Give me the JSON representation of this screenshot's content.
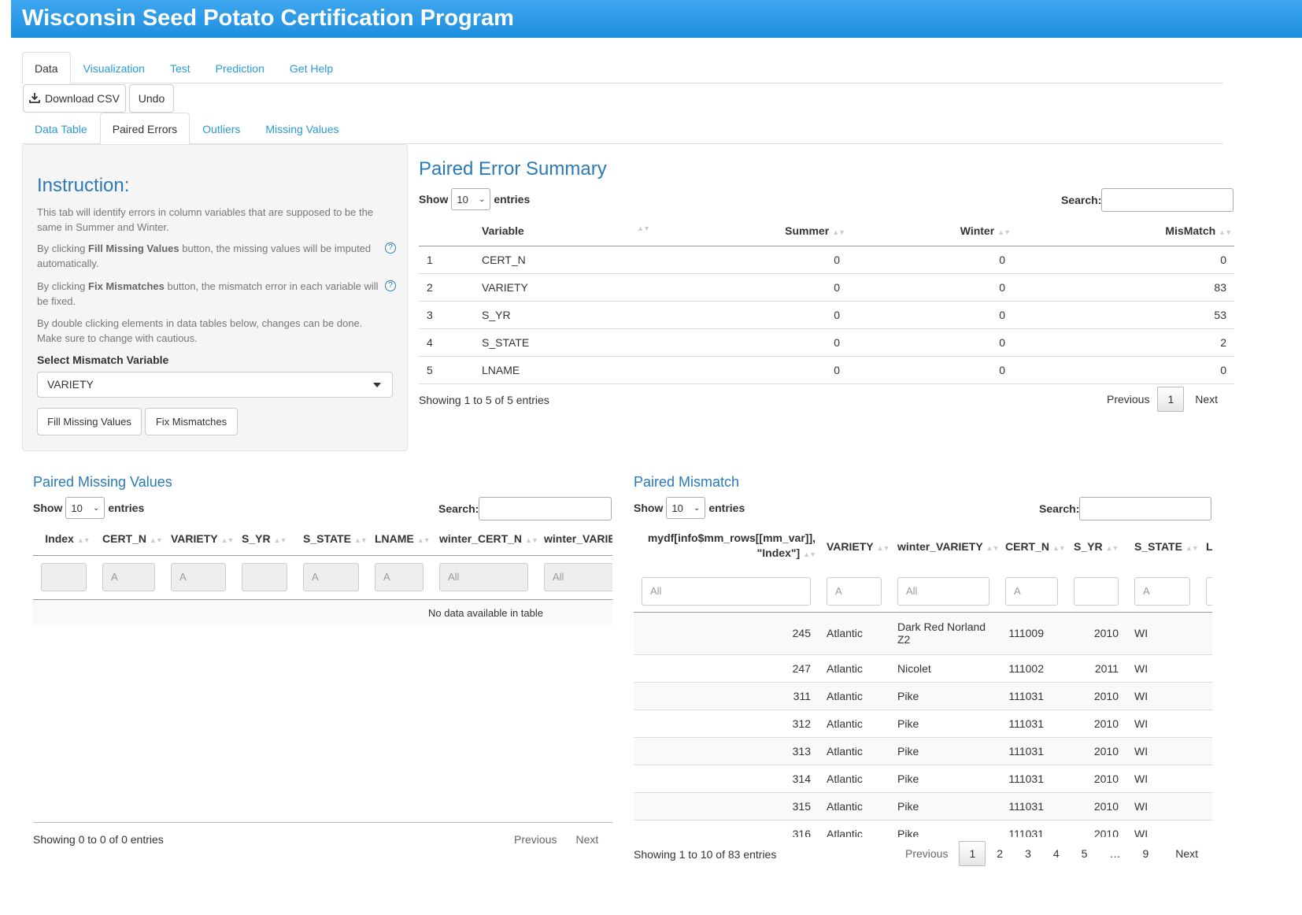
{
  "app": {
    "title": "Wisconsin Seed Potato Certification Program"
  },
  "main_tabs": [
    {
      "label": "Data",
      "active": true
    },
    {
      "label": "Visualization"
    },
    {
      "label": "Test"
    },
    {
      "label": "Prediction"
    },
    {
      "label": "Get Help"
    }
  ],
  "toolbar": {
    "download_label": "Download CSV",
    "undo_label": "Undo"
  },
  "sub_tabs": [
    {
      "label": "Data Table"
    },
    {
      "label": "Paired Errors",
      "active": true
    },
    {
      "label": "Outliers"
    },
    {
      "label": "Missing Values"
    }
  ],
  "sidebar": {
    "title": "Instruction:",
    "p1": "This tab will identify errors in column variables that are supposed to be the same in Summer and Winter.",
    "p2_prefix": "By clicking ",
    "p2_bold": "Fill Missing Values",
    "p2_suffix": " button, the missing values will be imputed automatically.",
    "p3_prefix": "By clicking ",
    "p3_bold": "Fix Mismatches",
    "p3_suffix": " button, the mismatch error in each variable will be fixed.",
    "p4": "By double clicking elements in data tables below, changes can be done. Make sure to change with cautious.",
    "select_label": "Select Mismatch Variable",
    "select_value": "VARIETY",
    "fill_button": "Fill Missing Values",
    "fix_button": "Fix Mismatches",
    "help_glyph": "?"
  },
  "common": {
    "show": "Show",
    "entries": "entries",
    "search": "Search:",
    "length": "10",
    "previous": "Previous",
    "next": "Next"
  },
  "summary": {
    "title": "Paired Error Summary",
    "headers": [
      "",
      "Variable",
      "Summer",
      "Winter",
      "MisMatch"
    ],
    "rows": [
      [
        "1",
        "CERT_N",
        "0",
        "0",
        "0"
      ],
      [
        "2",
        "VARIETY",
        "0",
        "0",
        "83"
      ],
      [
        "3",
        "S_YR",
        "0",
        "0",
        "53"
      ],
      [
        "4",
        "S_STATE",
        "0",
        "0",
        "2"
      ],
      [
        "5",
        "LNAME",
        "0",
        "0",
        "0"
      ]
    ],
    "info": "Showing 1 to 5 of 5 entries",
    "current_page": "1"
  },
  "missing": {
    "title": "Paired Missing Values",
    "headers": [
      "Index",
      "CERT_N",
      "VARIETY",
      "S_YR",
      "S_STATE",
      "LNAME",
      "winter_CERT_N",
      "winter_VARIETY"
    ],
    "filters": [
      "",
      "A",
      "A",
      "",
      "A",
      "A",
      "All",
      "All"
    ],
    "empty": "No data available in table",
    "info": "Showing 0 to 0 of 0 entries"
  },
  "mismatch": {
    "title": "Paired Mismatch",
    "headers": [
      "mydf[info$mm_rows[[mm_var]], \"Index\"]",
      "VARIETY",
      "winter_VARIETY",
      "CERT_N",
      "S_YR",
      "S_STATE",
      "LNAME"
    ],
    "filters": [
      "All",
      "A",
      "All",
      "A",
      "",
      "A",
      ""
    ],
    "rows": [
      [
        "245",
        "Atlantic",
        "Dark Red Norland Z2",
        "111009",
        "2010",
        "WI"
      ],
      [
        "247",
        "Atlantic",
        "Nicolet",
        "111002",
        "2011",
        "WI"
      ],
      [
        "311",
        "Atlantic",
        "Pike",
        "111031",
        "2010",
        "WI"
      ],
      [
        "312",
        "Atlantic",
        "Pike",
        "111031",
        "2010",
        "WI"
      ],
      [
        "313",
        "Atlantic",
        "Pike",
        "111031",
        "2010",
        "WI"
      ],
      [
        "314",
        "Atlantic",
        "Pike",
        "111031",
        "2010",
        "WI"
      ],
      [
        "315",
        "Atlantic",
        "Pike",
        "111031",
        "2010",
        "WI"
      ],
      [
        "316",
        "Atlantic",
        "Pike",
        "111031",
        "2010",
        "WI"
      ]
    ],
    "info": "Showing 1 to 10 of 83 entries",
    "pages": [
      "1",
      "2",
      "3",
      "4",
      "5",
      "…",
      "9"
    ]
  },
  "colors": {
    "title_bar": "#1d8fe0",
    "link": "#2a9ad6",
    "heading": "#2a7ab8"
  },
  "icons": {
    "download": "download-icon",
    "caret": "caret-down-icon",
    "help": "help-circle-icon"
  }
}
